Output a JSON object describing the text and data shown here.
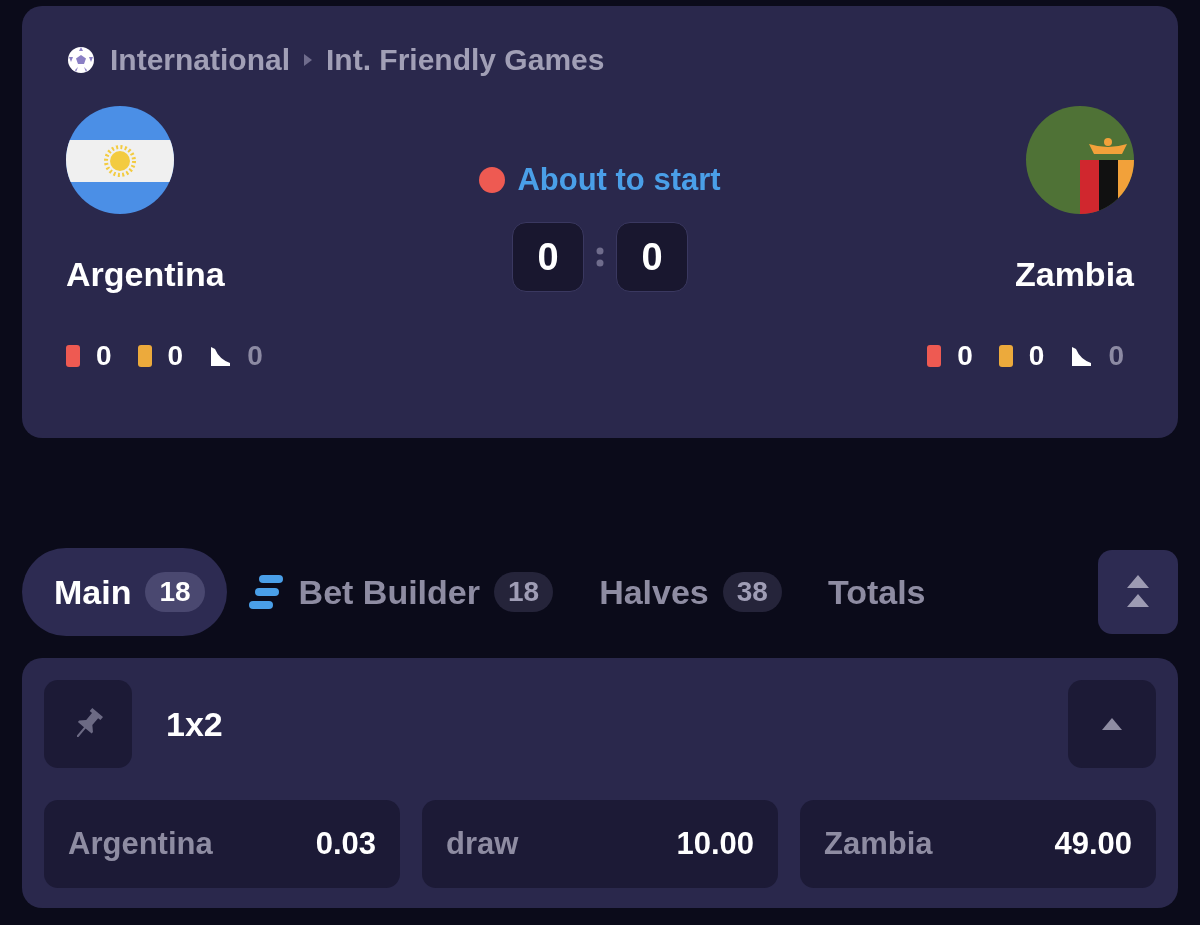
{
  "breadcrumb": [
    "International",
    "Int. Friendly Games"
  ],
  "match": {
    "status": "About to start",
    "home": {
      "name": "Argentina",
      "flag": {
        "kind": "argentina"
      },
      "stats": [
        {
          "kind": "red_card",
          "value": "0"
        },
        {
          "kind": "yellow_card",
          "value": "0"
        },
        {
          "kind": "corner",
          "value": "0"
        }
      ]
    },
    "away": {
      "name": "Zambia",
      "flag": {
        "kind": "zambia"
      },
      "stats": [
        {
          "kind": "red_card",
          "value": "0"
        },
        {
          "kind": "yellow_card",
          "value": "0"
        },
        {
          "kind": "corner",
          "value": "0"
        }
      ]
    },
    "score": [
      "0",
      "0"
    ]
  },
  "tabs": [
    {
      "label": "Main",
      "count": "18",
      "selected": true
    },
    {
      "label": "Bet Builder",
      "count": "18",
      "selected": false,
      "kind": "builder"
    },
    {
      "label": "Halves",
      "count": "38",
      "selected": false
    },
    {
      "label": "Totals",
      "selected": false
    }
  ],
  "market": {
    "title": "1x2",
    "pinned": false,
    "expanded": true,
    "odds": [
      {
        "label": "Argentina",
        "value": "0.03"
      },
      {
        "label": "draw",
        "value": "10.00"
      },
      {
        "label": "Zambia",
        "value": "49.00"
      }
    ]
  }
}
